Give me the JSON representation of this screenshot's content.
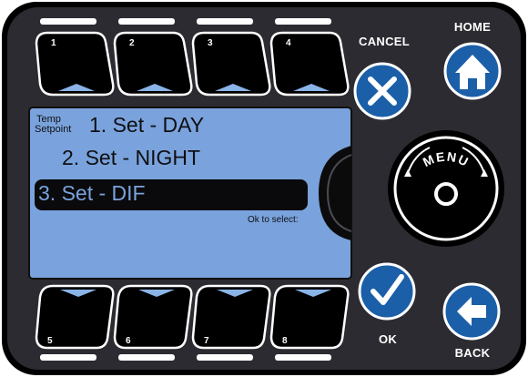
{
  "softkeys": {
    "top": [
      "1",
      "2",
      "3",
      "4"
    ],
    "bottom": [
      "5",
      "6",
      "7",
      "8"
    ]
  },
  "buttons": {
    "cancel": "CANCEL",
    "home": "HOME",
    "menu": "MENU",
    "ok": "OK",
    "back": "BACK"
  },
  "screen": {
    "context_line1": "Temp",
    "context_line2": "Setpoint",
    "items": [
      "1. Set - DAY",
      "2. Set - NIGHT",
      "3. Set - DIF"
    ],
    "selected_index": 2,
    "hint": "Ok to select:"
  },
  "colors": {
    "bezel": "#000000",
    "panel": "#2b2b31",
    "lcd": "#7aa3dd",
    "button_blue": "#1b5fa8",
    "accent_light_blue": "#8ab4e8"
  }
}
